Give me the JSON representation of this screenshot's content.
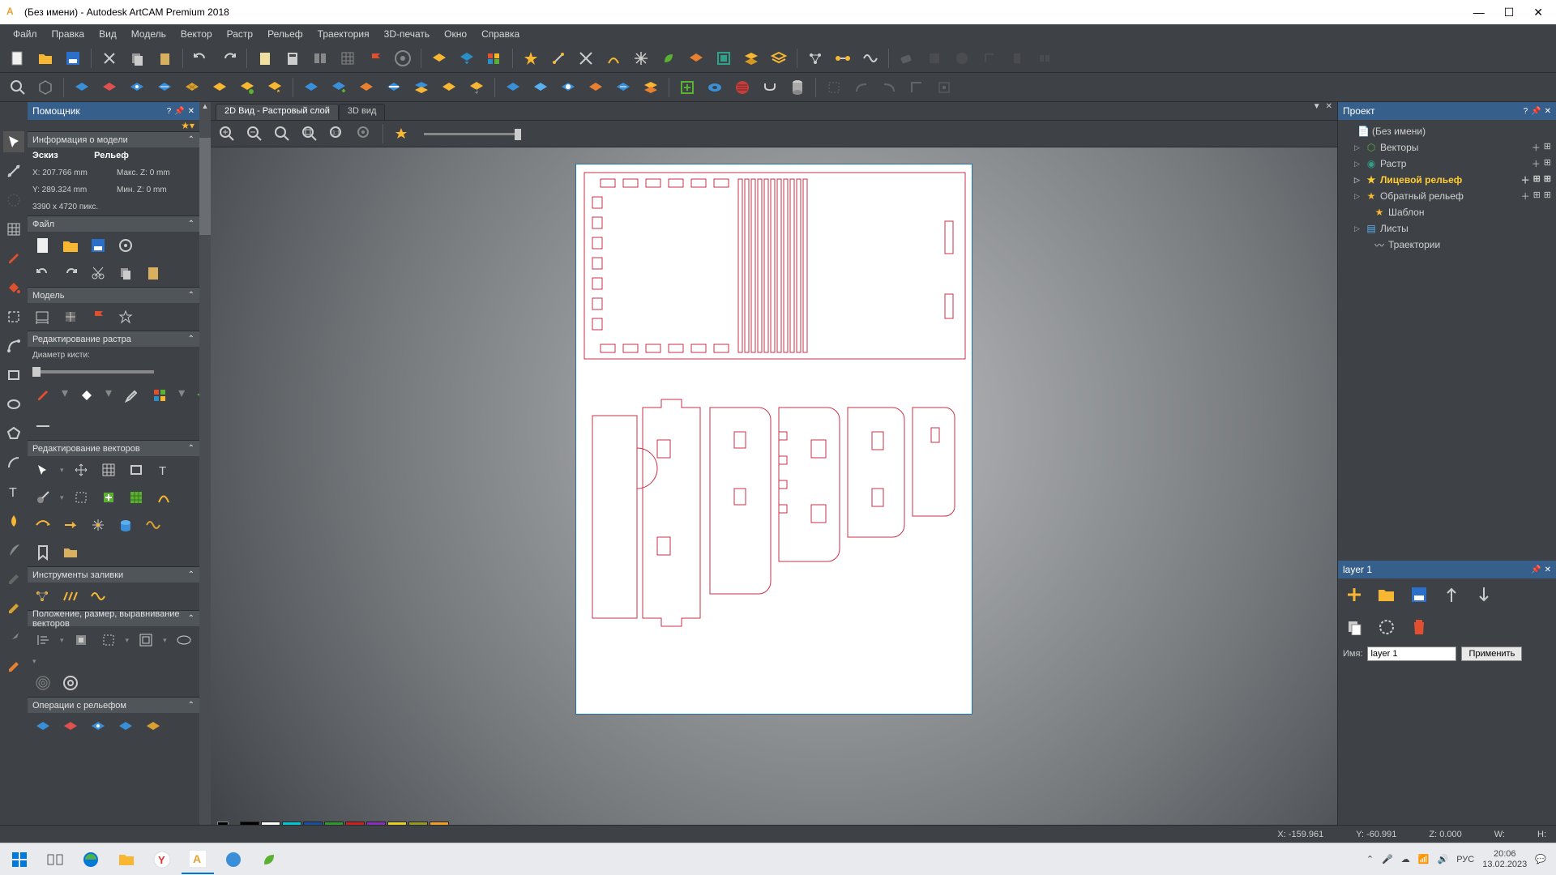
{
  "window": {
    "title": "(Без имени) - Autodesk ArtCAM Premium 2018"
  },
  "menu": [
    "Файл",
    "Правка",
    "Вид",
    "Модель",
    "Вектор",
    "Растр",
    "Рельеф",
    "Траектория",
    "3D-печать",
    "Окно",
    "Справка"
  ],
  "helper": {
    "title": "Помощник",
    "info_hdr": "Информация о модели",
    "sketch_label": "Эскиз",
    "relief_label": "Рельеф",
    "x": "X: 207.766 mm",
    "y": "Y: 289.324 mm",
    "dims": "3390 x 4720 пикс.",
    "maxz": "Макс. Z: 0 mm",
    "minz": "Мин. Z: 0 mm",
    "file_hdr": "Файл",
    "model_hdr": "Модель",
    "raster_hdr": "Редактирование растра",
    "brush_label": "Диаметр кисти:",
    "vector_hdr": "Редактирование векторов",
    "fill_hdr": "Инструменты заливки",
    "position_hdr": "Положение, размер, выравнивание векторов",
    "relief_ops_hdr": "Операции с рельефом"
  },
  "views": {
    "tab_2d": "2D Вид - Растровый слой",
    "tab_3d": "3D вид"
  },
  "project": {
    "title": "Проект",
    "root": "(Без имени)",
    "vectors": "Векторы",
    "raster": "Растр",
    "relief_front": "Лицевой рельеф",
    "relief_back": "Обратный рельеф",
    "template": "Шаблон",
    "sheets": "Листы",
    "toolpaths": "Траектории"
  },
  "layer_panel": {
    "title": "layer 1",
    "name_label": "Имя:",
    "name_value": "layer 1",
    "apply": "Применить"
  },
  "status": {
    "x": "X: -159.961",
    "y": "Y: -60.991",
    "z": "Z: 0.000",
    "w": "W:",
    "h": "H:"
  },
  "taskbar": {
    "lang": "РУС",
    "time": "20:06",
    "date": "13.02.2023"
  },
  "colors": [
    "#000000",
    "#ffffff",
    "#00c8d7",
    "#1b4fa0",
    "#2e9b2e",
    "#d02020",
    "#8a2fbf",
    "#e8d020",
    "#9a9a20",
    "#f7a020"
  ]
}
